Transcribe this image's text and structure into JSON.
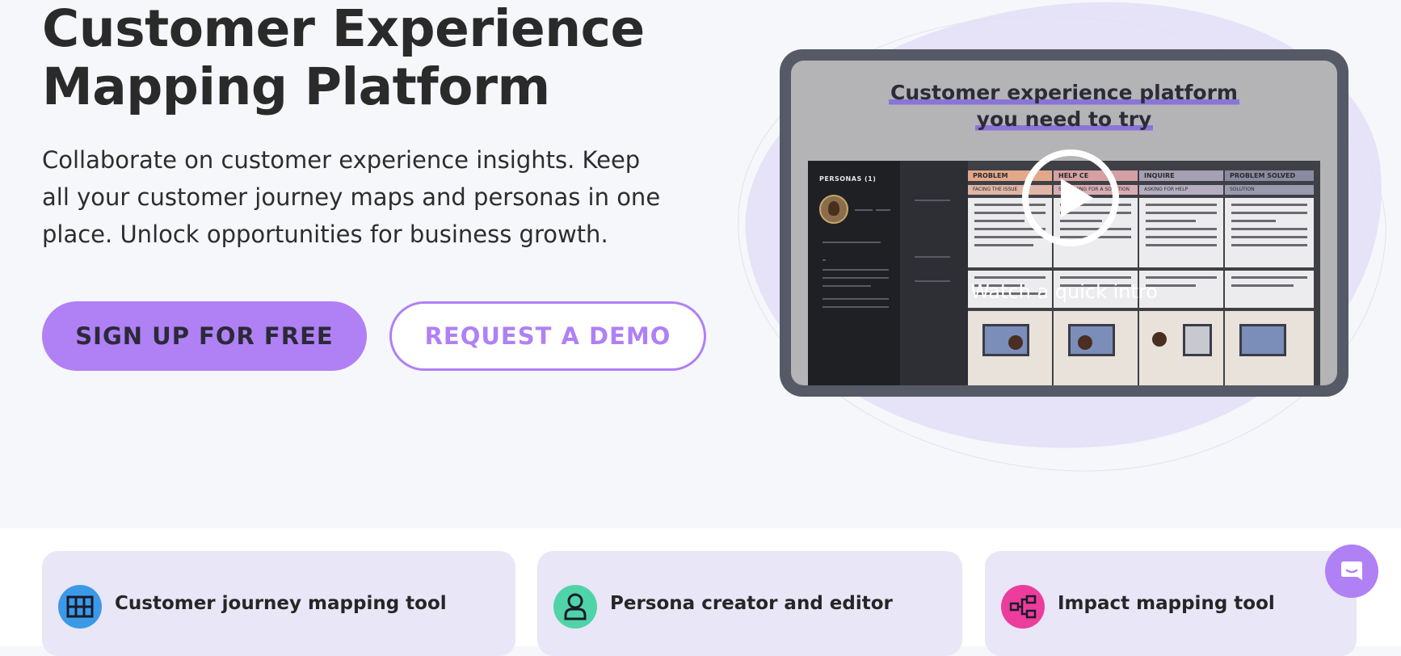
{
  "hero": {
    "title_line1": "Customer Experience",
    "title_line2": "Mapping Platform",
    "description_line1": "Collaborate on customer experience insights. Keep",
    "description_line2": "all your customer journey maps and personas in one",
    "description_line3": "place. Unlock opportunities for business growth."
  },
  "buttons": {
    "signup_label": "SIGN UP FOR FREE",
    "demo_label": "REQUEST A DEMO"
  },
  "video": {
    "caption_line1": "Customer experience platform",
    "caption_line2": "you need to try",
    "watch_label": "Watch a quick intro",
    "preview": {
      "personas_label": "PERSONAS  (1)",
      "stages": [
        "PROBLEM",
        "HELP CE",
        "INQUIRE",
        "PROBLEM SOLVED"
      ],
      "substages": [
        "FACING THE ISSUE",
        "SEARCHING FOR A SOLUTION",
        "ASKING FOR HELP",
        "SOLUTION"
      ],
      "stage_colors": [
        "#e3a88a",
        "#d4a0a4",
        "#a6a0b4",
        "#8a8aa0"
      ]
    }
  },
  "features": [
    {
      "label": "Customer journey mapping tool",
      "icon": "grid-table-icon",
      "icon_color": "#3b9ae8"
    },
    {
      "label": "Persona creator and editor",
      "icon": "user-icon",
      "icon_color": "#4fd4a8"
    },
    {
      "label": "Impact mapping tool",
      "icon": "flow-chart-icon",
      "icon_color": "#ec3d9c"
    }
  ],
  "colors": {
    "accent": "#b080f5",
    "background": "#f6f7fa",
    "card_background": "#e9e6f7"
  }
}
